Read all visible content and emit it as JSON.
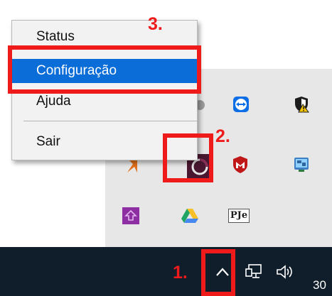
{
  "context_menu": {
    "items": [
      {
        "label": "Status"
      },
      {
        "label": "Configuração",
        "selected": true
      },
      {
        "label": "Ajuda"
      },
      {
        "label": "Sair"
      }
    ]
  },
  "annotations": [
    {
      "label": "1."
    },
    {
      "label": "2."
    },
    {
      "label": "3."
    }
  ],
  "tray_icons": [
    "teamviewer-icon",
    "windows-security-icon",
    "target-app-icon",
    "mcafee-icon",
    "network-monitor-icon",
    "purple-app-icon",
    "google-drive-icon",
    "pje-icon"
  ],
  "tray_pje_label": "PJe",
  "taskbar": {
    "clock_text": "30"
  },
  "colors": {
    "menu_highlight": "#0b6dd8",
    "annotation_red": "#ef1b1b",
    "taskbar_bg": "#101e2b",
    "flyout_bg": "#e7e7e7"
  }
}
